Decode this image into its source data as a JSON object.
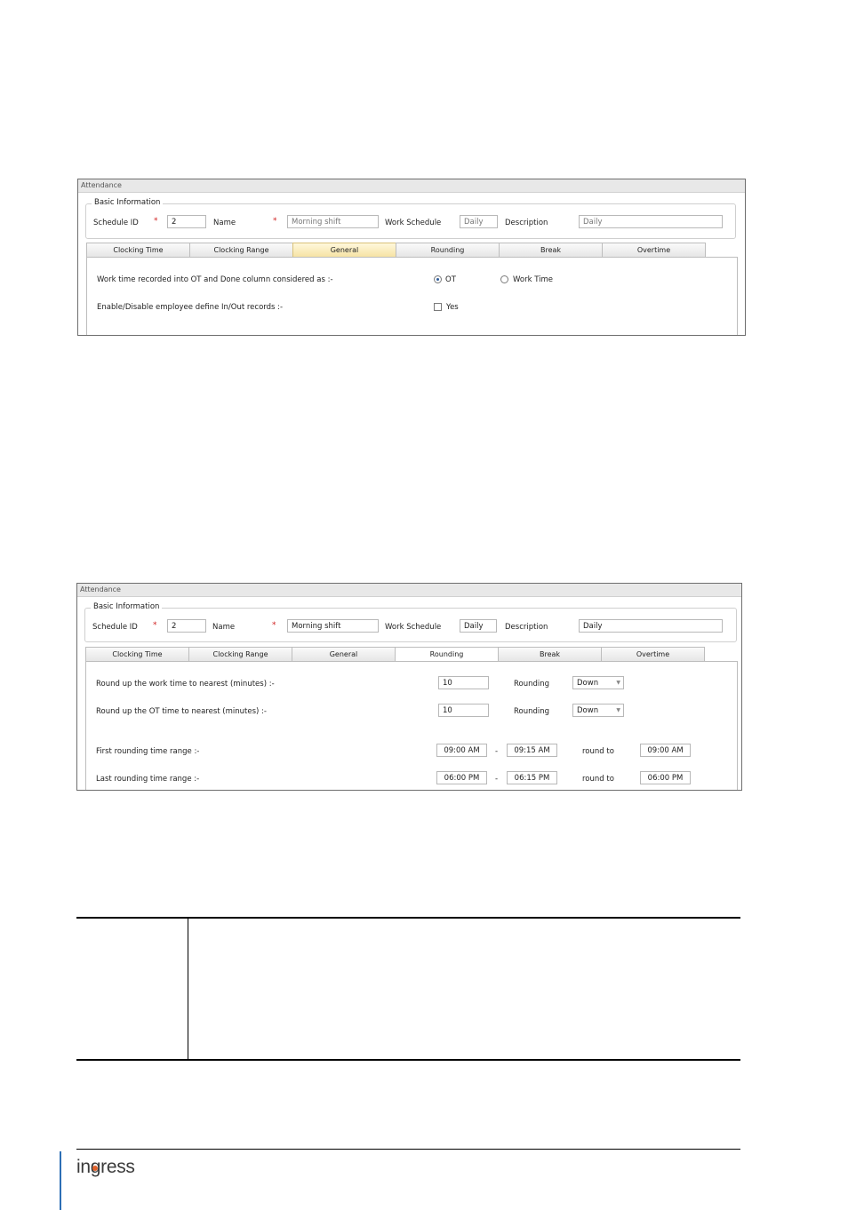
{
  "screenshot1": {
    "window_title": "Attendance",
    "group_title": "Basic Information",
    "schedule_id_label": "Schedule ID",
    "required_mark": "*",
    "schedule_id_value": "2",
    "name_label": "Name",
    "name_value": "Morning shift",
    "work_schedule_label": "Work Schedule",
    "work_schedule_value": "Daily",
    "description_label": "Description",
    "description_value": "Daily",
    "tabs": [
      "Clocking Time",
      "Clocking Range",
      "General",
      "Rounding",
      "Break",
      "Overtime"
    ],
    "active_tab": "General",
    "row1_label": "Work time recorded into OT and Done column considered as :-",
    "radio_ot": "OT",
    "radio_work_time": "Work Time",
    "row2_label": "Enable/Disable employee define In/Out records :-",
    "checkbox_yes": "Yes"
  },
  "screenshot2": {
    "window_title": "Attendance",
    "group_title": "Basic Information",
    "schedule_id_label": "Schedule ID",
    "required_mark": "*",
    "schedule_id_value": "2",
    "name_label": "Name",
    "name_value": "Morning shift",
    "work_schedule_label": "Work Schedule",
    "work_schedule_value": "Daily",
    "description_label": "Description",
    "description_value": "Daily",
    "tabs": [
      "Clocking Time",
      "Clocking Range",
      "General",
      "Rounding",
      "Break",
      "Overtime"
    ],
    "active_tab": "Rounding",
    "work_round_label": "Round up the work time to nearest (minutes) :-",
    "work_round_value": "10",
    "rounding_label": "Rounding",
    "work_round_mode": "Down",
    "ot_round_label": "Round up the OT time to nearest (minutes) :-",
    "ot_round_value": "10",
    "ot_round_mode": "Down",
    "first_range_label": "First rounding time range :-",
    "first_from": "09:00 AM",
    "dash": "-",
    "first_to": "09:15 AM",
    "round_to_label": "round to",
    "first_round_to": "09:00 AM",
    "last_range_label": "Last rounding time range :-",
    "last_from": "06:00 PM",
    "last_to": "06:15 PM",
    "last_round_to": "06:00 PM"
  },
  "footer": {
    "logo_text": "ingress",
    "logo_dot_color": "#e0612b"
  }
}
